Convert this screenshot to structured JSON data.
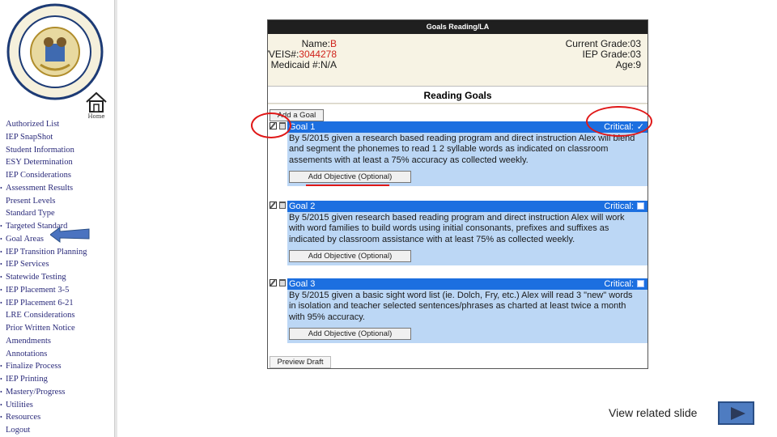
{
  "sidebar": {
    "home_label": "Home",
    "items": [
      {
        "label": "Authorized List",
        "bullet": false
      },
      {
        "label": "IEP SnapShot",
        "bullet": false
      },
      {
        "label": "Student Information",
        "bullet": false
      },
      {
        "label": "ESY Determination",
        "bullet": false
      },
      {
        "label": "IEP Considerations",
        "bullet": false
      },
      {
        "label": "Assessment Results",
        "bullet": true
      },
      {
        "label": "Present Levels",
        "bullet": false
      },
      {
        "label": "Standard Type",
        "bullet": false
      },
      {
        "label": "Targeted Standard",
        "bullet": true
      },
      {
        "label": "Goal Areas",
        "bullet": true
      },
      {
        "label": "IEP Transition Planning",
        "bullet": true
      },
      {
        "label": "IEP Services",
        "bullet": true
      },
      {
        "label": "Statewide Testing",
        "bullet": true
      },
      {
        "label": "IEP Placement 3-5",
        "bullet": true
      },
      {
        "label": "IEP Placement 6-21",
        "bullet": true
      },
      {
        "label": "LRE Considerations",
        "bullet": false
      },
      {
        "label": "Prior Written Notice",
        "bullet": false
      },
      {
        "label": "Amendments",
        "bullet": false
      },
      {
        "label": "Annotations",
        "bullet": false
      },
      {
        "label": "Finalize Process",
        "bullet": true
      },
      {
        "label": "IEP Printing",
        "bullet": true
      },
      {
        "label": "Mastery/Progress",
        "bullet": true
      },
      {
        "label": "Utilities",
        "bullet": true
      },
      {
        "label": "Resources",
        "bullet": true
      },
      {
        "label": "Logout",
        "bullet": false
      }
    ]
  },
  "panel": {
    "title": "Goals Reading/LA",
    "student": {
      "name_label": "Name:",
      "name_value": "B",
      "wveis_label": "WVEIS#:",
      "wveis_value": "3044278",
      "medicaid_label": "Medicaid #:",
      "medicaid_value": "N/A",
      "current_grade": "Current Grade:03",
      "iep_grade": "IEP Grade:03",
      "age": "Age:9"
    },
    "section_title": "Reading Goals",
    "add_goal_label": "Add a Goal",
    "add_objective_label": "Add Objective (Optional)",
    "critical_label": "Critical:",
    "preview_draft_label": "Preview Draft",
    "goals": [
      {
        "title": "Goal 1",
        "critical": "✓",
        "text": "By 5/2015 given a research based reading program and direct instruction Alex will blend and segment the phonemes to read 1 2 syllable words as indicated on classroom assements with at least a 75% accuracy as collected weekly."
      },
      {
        "title": "Goal 2",
        "critical": "",
        "text": "By 5/2015 given research based reading program and direct instruction Alex will work with word families to build words using initial consonants, prefixes and suffixes as indicated by classroom assistance with at least 75% as collected weekly."
      },
      {
        "title": "Goal 3",
        "critical": "",
        "text": "By 5/2015 given a basic sight word list (ie. Dolch, Fry, etc.) Alex will read 3 \"new\" words in isolation and teacher selected sentences/phrases as charted at least twice a month with 95% accuracy."
      }
    ]
  },
  "footer": {
    "related_label": "View related slide"
  },
  "colors": {
    "goal_header": "#1c6fe0",
    "goal_body": "#bcd7f5",
    "highlight_red": "#d0231b",
    "annotation_red": "#e01818"
  }
}
